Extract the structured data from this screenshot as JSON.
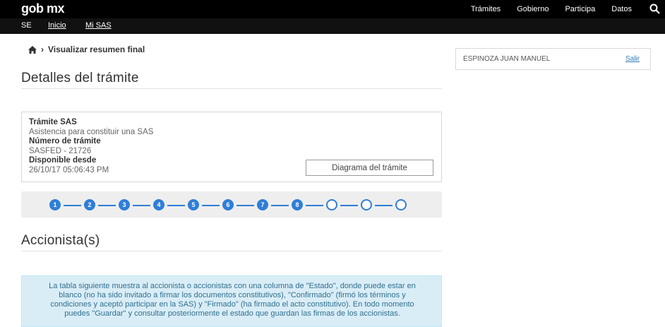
{
  "topbar": {
    "logo": "gob mx",
    "nav": [
      "Trámites",
      "Gobierno",
      "Participa",
      "Datos"
    ],
    "bg_color": "#000000"
  },
  "subbar": {
    "brand": "SE",
    "links": [
      "Inicio",
      "Mi SAS"
    ]
  },
  "breadcrumb": {
    "current": "Visualizar resumen final"
  },
  "user": {
    "name": "ESPINOZA JUAN MANUEL",
    "logout": "Salir"
  },
  "details": {
    "heading": "Detalles del trámite",
    "tramite_label": "Trámite SAS",
    "tramite_value": "Asistencia para constituir una SAS",
    "numero_label": "Número de trámite",
    "numero_value": "SASFED - 21726",
    "disponible_label": "Disponible desde",
    "disponible_value": "26/10/17 05:06:43 PM",
    "diagram_button": "Diagrama del trámite"
  },
  "progress": {
    "steps": [
      "1",
      "2",
      "3",
      "4",
      "5",
      "6",
      "7",
      "8",
      "",
      "",
      ""
    ],
    "completed": 8,
    "accent_color": "#2f7ed8"
  },
  "shareholders": {
    "heading": "Accionista(s)",
    "info": "La tabla siguiente muestra al accionista o accionistas con una columna de \"Estado\", donde puede estar en blanco (no ha sido invitado a firmar los documentos constitutivos), \"Confirmado\" (firmó los términos y condiciones y aceptó participar en la SAS) y \"Firmado\" (ha firmado el acto constitutivo). En todo momento puedes \"Guardar\" y consultar posteriormente el estado que guardan las firmas de los accionistas."
  }
}
